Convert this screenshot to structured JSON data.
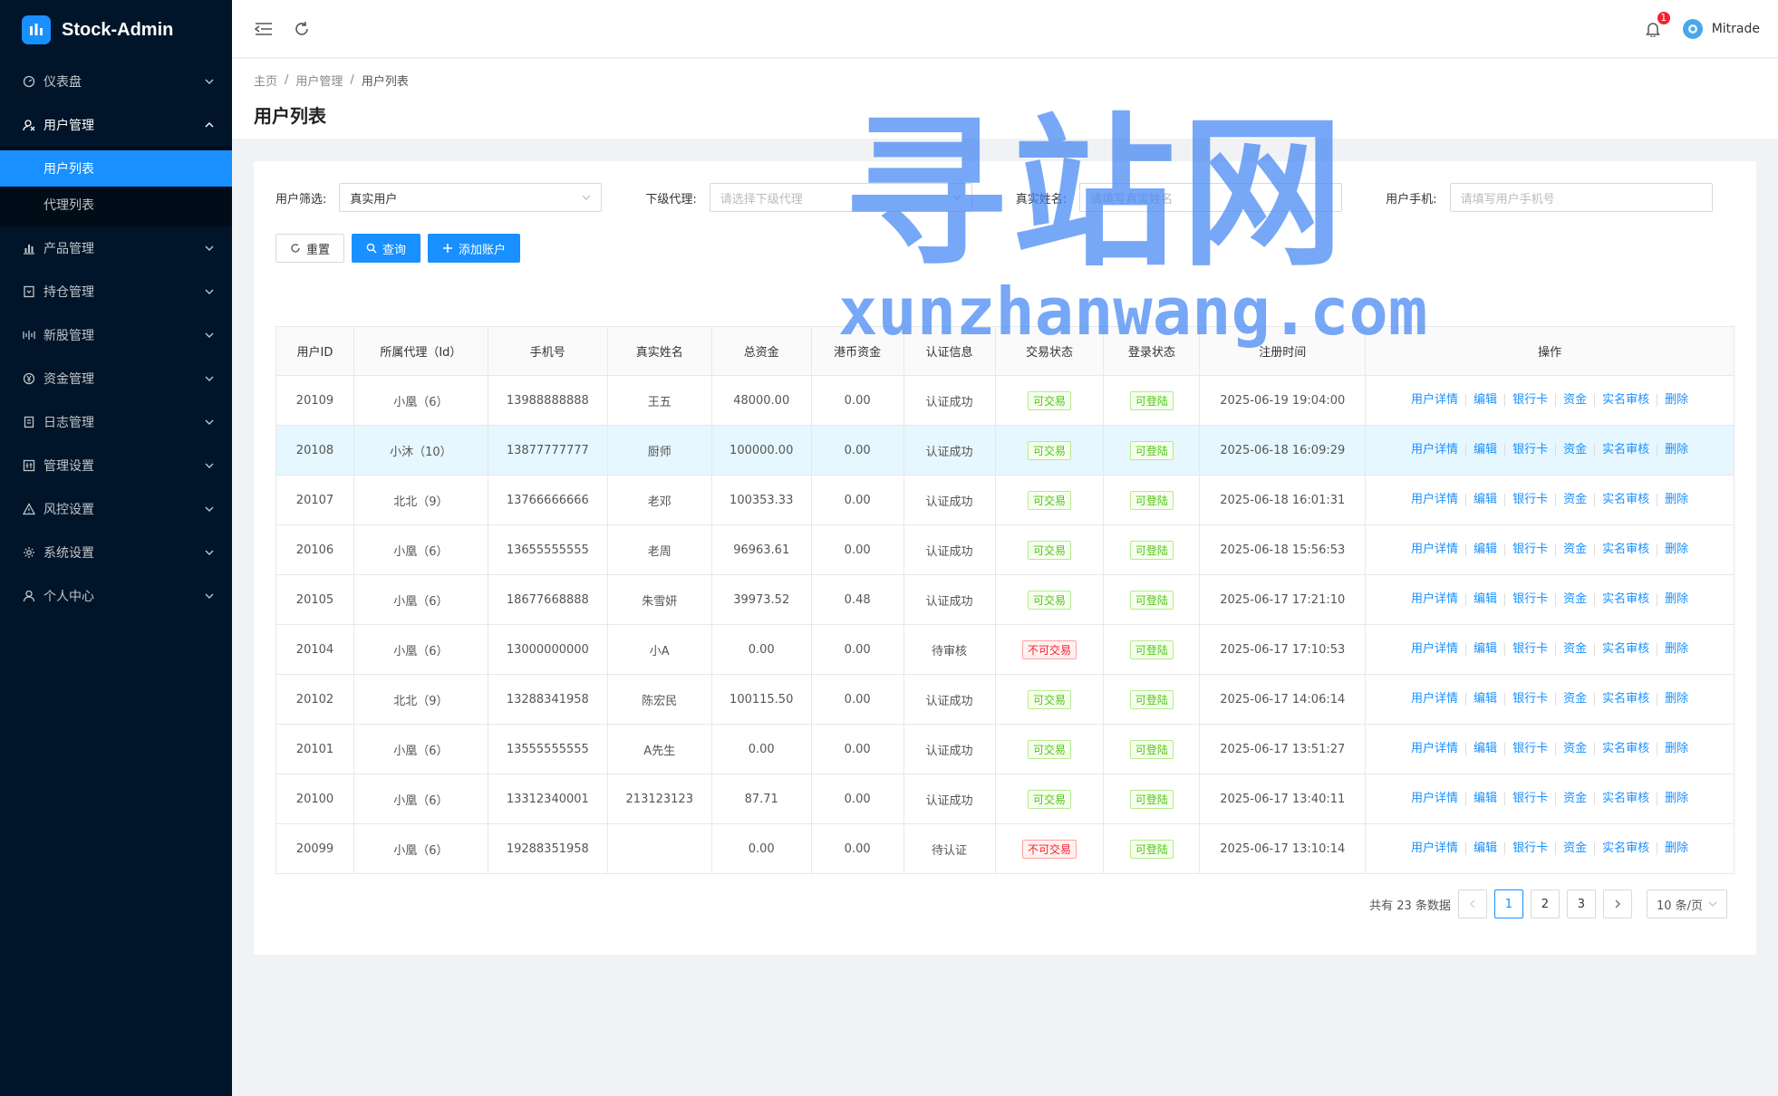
{
  "app": {
    "title": "Stock-Admin"
  },
  "sidebar": {
    "items": [
      {
        "label": "仪表盘",
        "icon": "dashboard-icon"
      },
      {
        "label": "用户管理",
        "icon": "user-manage-icon",
        "open": true,
        "children": [
          {
            "label": "用户列表",
            "active": true
          },
          {
            "label": "代理列表"
          }
        ]
      },
      {
        "label": "产品管理",
        "icon": "bar-chart-icon"
      },
      {
        "label": "持仓管理",
        "icon": "position-icon"
      },
      {
        "label": "新股管理",
        "icon": "ipo-icon"
      },
      {
        "label": "资金管理",
        "icon": "money-icon"
      },
      {
        "label": "日志管理",
        "icon": "log-icon"
      },
      {
        "label": "管理设置",
        "icon": "admin-settings-icon"
      },
      {
        "label": "风控设置",
        "icon": "warning-icon"
      },
      {
        "label": "系统设置",
        "icon": "gear-icon"
      },
      {
        "label": "个人中心",
        "icon": "person-icon"
      }
    ]
  },
  "header": {
    "notification_count": "1",
    "user_name": "Mitrade"
  },
  "breadcrumb": [
    "主页",
    "用户管理",
    "用户列表"
  ],
  "page_title": "用户列表",
  "filters": {
    "user_filter": {
      "label": "用户筛选:",
      "value": "真实用户"
    },
    "agent": {
      "label": "下级代理:",
      "placeholder": "请选择下级代理"
    },
    "real_name": {
      "label": "真实姓名:",
      "placeholder": "请填写真实姓名"
    },
    "phone": {
      "label": "用户手机:",
      "placeholder": "请填写用户手机号"
    }
  },
  "buttons": {
    "reset": "重置",
    "query": "查询",
    "add": "添加账户"
  },
  "table": {
    "columns": [
      "用户ID",
      "所属代理（Id）",
      "手机号",
      "真实姓名",
      "总资金",
      "港币资金",
      "认证信息",
      "交易状态",
      "登录状态",
      "注册时间",
      "操作"
    ],
    "actions": [
      "用户详情",
      "编辑",
      "银行卡",
      "资金",
      "实名审核",
      "删除"
    ],
    "rows": [
      {
        "id": "20109",
        "agent": "小凰（6）",
        "phone": "13988888888",
        "name": "王五",
        "total": "48000.00",
        "hkd": "0.00",
        "auth": "认证成功",
        "trade": "可交易",
        "trade_ok": true,
        "login": "可登陆",
        "time": "2025-06-19 19:04:00"
      },
      {
        "id": "20108",
        "agent": "小沐（10）",
        "phone": "13877777777",
        "name": "厨师",
        "total": "100000.00",
        "hkd": "0.00",
        "auth": "认证成功",
        "trade": "可交易",
        "trade_ok": true,
        "login": "可登陆",
        "time": "2025-06-18 16:09:29",
        "highlight": true
      },
      {
        "id": "20107",
        "agent": "北北（9）",
        "phone": "13766666666",
        "name": "老邓",
        "total": "100353.33",
        "hkd": "0.00",
        "auth": "认证成功",
        "trade": "可交易",
        "trade_ok": true,
        "login": "可登陆",
        "time": "2025-06-18 16:01:31"
      },
      {
        "id": "20106",
        "agent": "小凰（6）",
        "phone": "13655555555",
        "name": "老周",
        "total": "96963.61",
        "hkd": "0.00",
        "auth": "认证成功",
        "trade": "可交易",
        "trade_ok": true,
        "login": "可登陆",
        "time": "2025-06-18 15:56:53"
      },
      {
        "id": "20105",
        "agent": "小凰（6）",
        "phone": "18677668888",
        "name": "朱雪妍",
        "total": "39973.52",
        "hkd": "0.48",
        "auth": "认证成功",
        "trade": "可交易",
        "trade_ok": true,
        "login": "可登陆",
        "time": "2025-06-17 17:21:10"
      },
      {
        "id": "20104",
        "agent": "小凰（6）",
        "phone": "13000000000",
        "name": "小A",
        "total": "0.00",
        "hkd": "0.00",
        "auth": "待审核",
        "trade": "不可交易",
        "trade_ok": false,
        "login": "可登陆",
        "time": "2025-06-17 17:10:53"
      },
      {
        "id": "20102",
        "agent": "北北（9）",
        "phone": "13288341958",
        "name": "陈宏民",
        "total": "100115.50",
        "hkd": "0.00",
        "auth": "认证成功",
        "trade": "可交易",
        "trade_ok": true,
        "login": "可登陆",
        "time": "2025-06-17 14:06:14"
      },
      {
        "id": "20101",
        "agent": "小凰（6）",
        "phone": "13555555555",
        "name": "A先生",
        "total": "0.00",
        "hkd": "0.00",
        "auth": "认证成功",
        "trade": "可交易",
        "trade_ok": true,
        "login": "可登陆",
        "time": "2025-06-17 13:51:27"
      },
      {
        "id": "20100",
        "agent": "小凰（6）",
        "phone": "13312340001",
        "name": "213123123",
        "total": "87.71",
        "hkd": "0.00",
        "auth": "认证成功",
        "trade": "可交易",
        "trade_ok": true,
        "login": "可登陆",
        "time": "2025-06-17 13:40:11"
      },
      {
        "id": "20099",
        "agent": "小凰（6）",
        "phone": "19288351958",
        "name": "",
        "total": "0.00",
        "hkd": "0.00",
        "auth": "待认证",
        "trade": "不可交易",
        "trade_ok": false,
        "login": "可登陆",
        "time": "2025-06-17 13:10:14"
      }
    ]
  },
  "pagination": {
    "summary": "共有 23 条数据",
    "pages": [
      "1",
      "2",
      "3"
    ],
    "current": "1",
    "page_size": "10 条/页"
  },
  "watermark": {
    "cn": "寻站网",
    "en": "xunzhanwang.com"
  },
  "colors": {
    "sidebar": "#001529",
    "accent": "#1890ff",
    "success": "#52c41a",
    "danger": "#f5222d"
  }
}
